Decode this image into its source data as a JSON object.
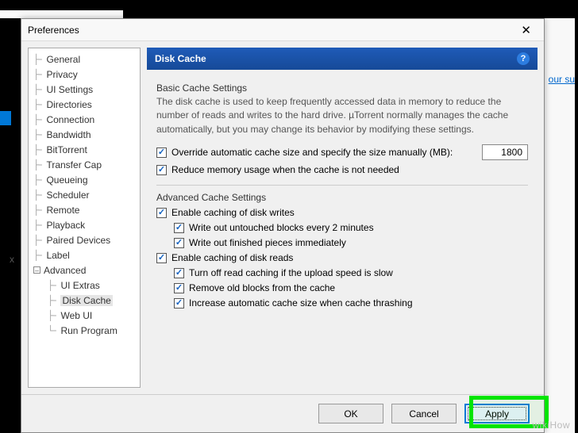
{
  "dialog": {
    "title": "Preferences",
    "close_glyph": "✕"
  },
  "tree": {
    "items": [
      "General",
      "Privacy",
      "UI Settings",
      "Directories",
      "Connection",
      "Bandwidth",
      "BitTorrent",
      "Transfer Cap",
      "Queueing",
      "Scheduler",
      "Remote",
      "Playback",
      "Paired Devices",
      "Label"
    ],
    "advanced_label": "Advanced",
    "advanced_children": [
      "UI Extras",
      "Disk Cache",
      "Web UI",
      "Run Program"
    ],
    "selected": "Disk Cache"
  },
  "panel": {
    "header": "Disk Cache",
    "help_glyph": "?",
    "basic": {
      "title": "Basic Cache Settings",
      "desc": "The disk cache is used to keep frequently accessed data in memory to reduce the number of reads and writes to the hard drive. µTorrent normally manages the cache automatically, but you may change its behavior by modifying these settings.",
      "override": "Override automatic cache size and specify the size manually (MB):",
      "size_value": "1800",
      "reduce": "Reduce memory usage when the cache is not needed"
    },
    "adv": {
      "title": "Advanced Cache Settings",
      "enable_writes": "Enable caching of disk writes",
      "write_untouched": "Write out untouched blocks every 2 minutes",
      "write_finished": "Write out finished pieces immediately",
      "enable_reads": "Enable caching of disk reads",
      "turn_off": "Turn off read caching if the upload speed is slow",
      "remove_old": "Remove old blocks from the cache",
      "increase": "Increase automatic cache size when cache thrashing"
    }
  },
  "buttons": {
    "ok": "OK",
    "cancel": "Cancel",
    "apply": "Apply"
  },
  "bg": {
    "link": "our su",
    "x": "x"
  },
  "watermark": "wikiHow"
}
